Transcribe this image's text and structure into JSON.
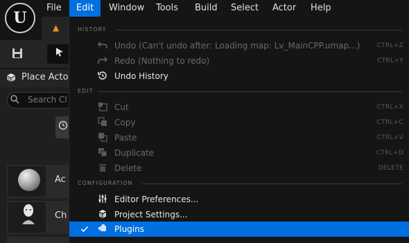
{
  "menubar": {
    "logo": "unreal-logo",
    "menus": [
      "File",
      "Edit",
      "Window",
      "Tools",
      "Build",
      "Select",
      "Actor",
      "Help"
    ],
    "active_menu": "Edit"
  },
  "left_panel": {
    "title": "Place Actor",
    "search_placeholder": "Search Cl",
    "actors": [
      {
        "label": "Ac",
        "thumb": "sphere-icon"
      },
      {
        "label": "Ch",
        "thumb": "character-head-icon"
      }
    ]
  },
  "edit_menu": {
    "sections": {
      "history": "HISTORY",
      "edit": "EDIT",
      "configuration": "CONFIGURATION"
    },
    "items": {
      "undo": {
        "label": "Undo (Can't undo after: Loading map: Lv_MainCPP.umap...)",
        "shortcut": "CTRL+Z",
        "icon": "undo-icon"
      },
      "redo": {
        "label": "Redo (Nothing to redo)",
        "shortcut": "CTRL+Y",
        "icon": "redo-icon"
      },
      "undo_history": {
        "label": "Undo History",
        "icon": "history-icon"
      },
      "cut": {
        "label": "Cut",
        "shortcut": "CTRL+X",
        "icon": "cut-icon"
      },
      "copy": {
        "label": "Copy",
        "shortcut": "CTRL+C",
        "icon": "copy-icon"
      },
      "paste": {
        "label": "Paste",
        "shortcut": "CTRL+V",
        "icon": "paste-icon"
      },
      "duplicate": {
        "label": "Duplicate",
        "shortcut": "CTRL+D",
        "icon": "duplicate-icon"
      },
      "delete": {
        "label": "Delete",
        "shortcut": "DELETE",
        "icon": "trash-icon"
      },
      "editor_preferences": {
        "label": "Editor Preferences...",
        "icon": "sliders-icon"
      },
      "project_settings": {
        "label": "Project Settings...",
        "icon": "settings-icon"
      },
      "plugins": {
        "label": "Plugins",
        "icon": "plugin-icon",
        "checked": true
      }
    }
  },
  "colors": {
    "accent": "#0070e0",
    "background": "#151515",
    "text_enabled": "#e6e6e6",
    "text_disabled": "#6a6a6a",
    "tab_icon": "#f28c28"
  }
}
